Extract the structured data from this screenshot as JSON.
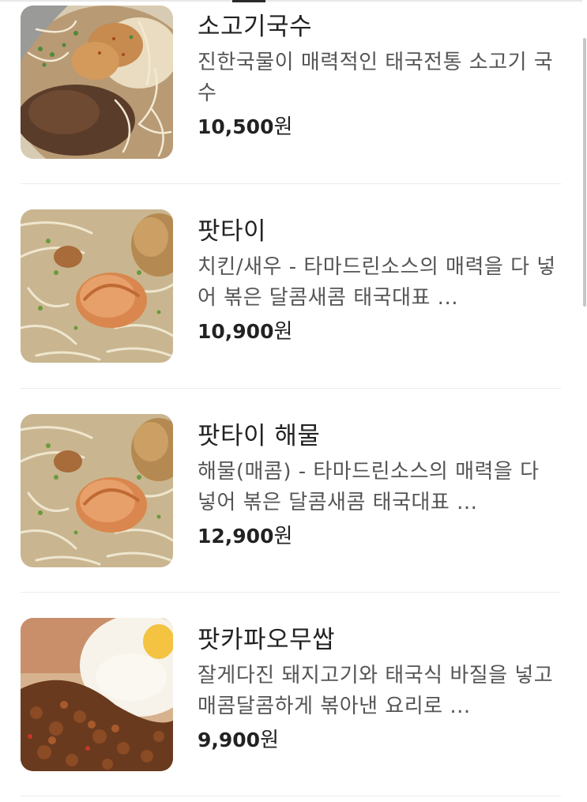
{
  "menu": {
    "items": [
      {
        "name": "소고기국수",
        "description": "진한국물이 매력적인 태국전통 소고기 국수",
        "price": "10,500",
        "currency": "원",
        "image_icon": "beef-noodle-soup-photo"
      },
      {
        "name": "팟타이",
        "description": "치킨/새우 - 타마드린소스의 매력을 다 넣어 볶은 달콤새콤 태국대표 ...",
        "price": "10,900",
        "currency": "원",
        "image_icon": "pad-thai-photo"
      },
      {
        "name": "팟타이 해물",
        "description": "해물(매콤) - 타마드린소스의 매력을 다 넣어 볶은 달콤새콤 태국대표 ...",
        "price": "12,900",
        "currency": "원",
        "image_icon": "pad-thai-seafood-photo"
      },
      {
        "name": "팟카파오무쌉",
        "description": "잘게다진 돼지고기와 태국식 바질을 넣고 매콤달콤하게 볶아낸 요리로 ...",
        "price": "9,900",
        "currency": "원",
        "image_icon": "pad-kra-pao-photo"
      }
    ]
  }
}
